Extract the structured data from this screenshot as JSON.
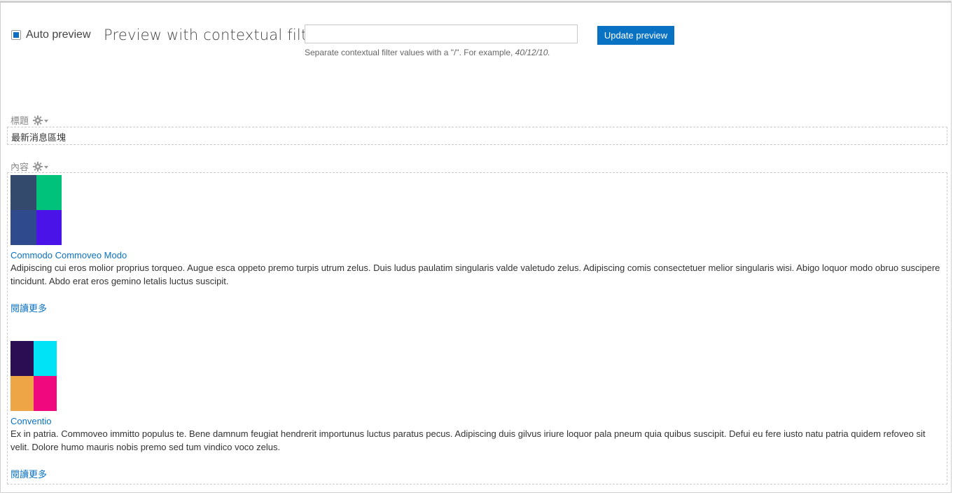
{
  "preview": {
    "auto_preview_label": "Auto preview",
    "auto_preview_checked": true,
    "title": "Preview with contextual filters:",
    "input_value": "",
    "input_placeholder": "",
    "help_prefix": "Separate contextual filter values with a \"/\". For example, ",
    "help_example": "40/12/10.",
    "update_button": "Update preview"
  },
  "fields": {
    "title_label": "標題",
    "title_value": "最新消息區塊",
    "content_label": "內容"
  },
  "items": [
    {
      "title": "Commodo Commoveo Modo",
      "body": "Adipiscing cui eros molior proprius torqueo. Augue esca oppeto premo turpis utrum zelus. Duis ludus paulatim singularis valde valetudo zelus. Adipiscing comis consectetuer melior singularis wisi. Abigo loquor modo obruo suscipere tincidunt. Abdo erat eros gemino letalis luctus suscipit.",
      "read_more": "閱讀更多",
      "thumb_colors": [
        "#334a6c",
        "#00c27a",
        "#2f4b8e",
        "#4a14e8"
      ]
    },
    {
      "title": "Conventio",
      "body": "Ex in patria. Commoveo immitto populus te. Bene damnum feugiat hendrerit importunus luctus paratus pecus. Adipiscing duis gilvus iriure loquor pala pneum quia quibus suscipit. Defui eu fere iusto natu patria quidem refoveo sit velit. Dolore humo mauris nobis premo sed tum vindico voco zelus.",
      "read_more": "閱讀更多",
      "thumb_colors": [
        "#2a0d52",
        "#00e3f6",
        "#eea546",
        "#f0087f"
      ]
    }
  ],
  "icons": {
    "gear": "gear-icon",
    "dropdown": "chevron-down-icon"
  }
}
